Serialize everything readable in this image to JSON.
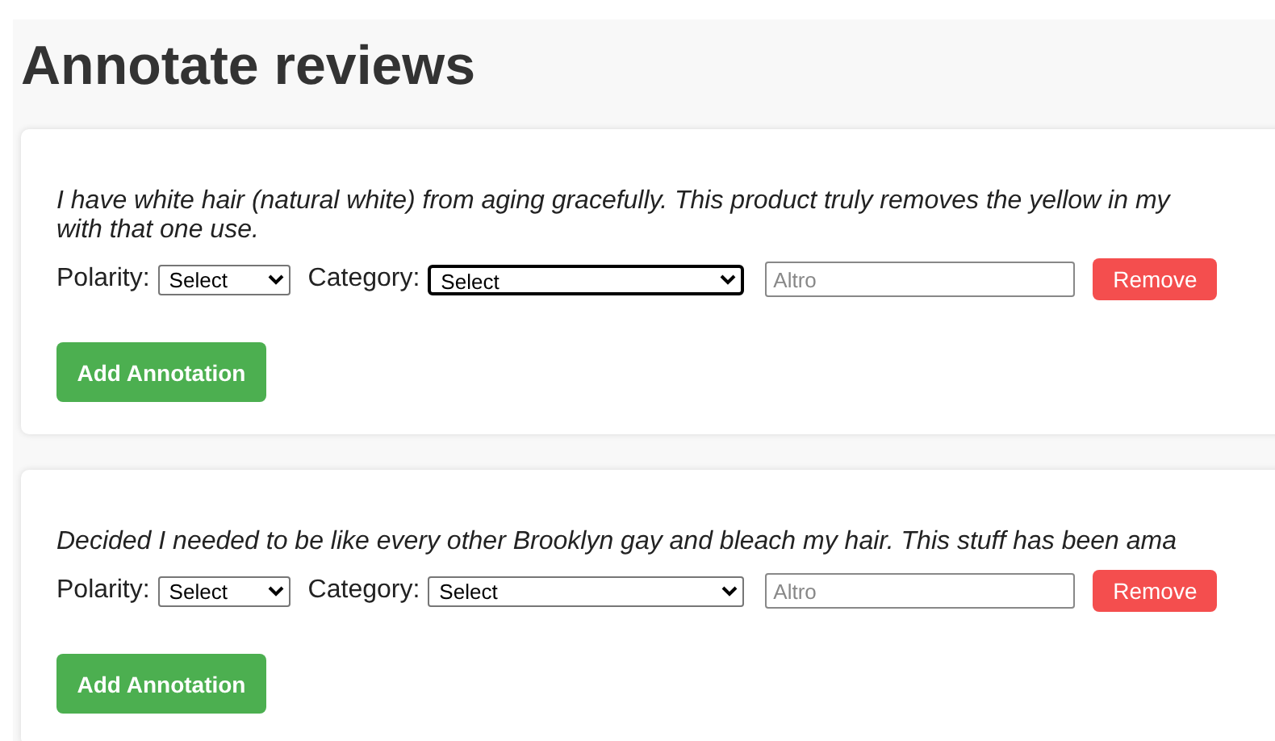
{
  "title": "Annotate reviews",
  "reviews": [
    {
      "text_lines": [
        "I have white hair (natural white) from aging gracefully. This product truly removes the yellow in my",
        "with that one use."
      ],
      "annotations": [
        {
          "polarity_label": "Polarity:",
          "polarity_value": "Select",
          "category_label": "Category:",
          "category_value": "Select",
          "category_focused": true,
          "other_placeholder": "Altro",
          "remove": "Remove"
        }
      ],
      "add_button": "Add Annotation"
    },
    {
      "text_lines": [
        "Decided I needed to be like every other Brooklyn gay and bleach my hair. This stuff has been ama"
      ],
      "annotations": [
        {
          "polarity_label": "Polarity:",
          "polarity_value": "Select",
          "category_label": "Category:",
          "category_value": "Select",
          "category_focused": false,
          "other_placeholder": "Altro",
          "remove": "Remove"
        }
      ],
      "add_button": "Add Annotation"
    }
  ]
}
